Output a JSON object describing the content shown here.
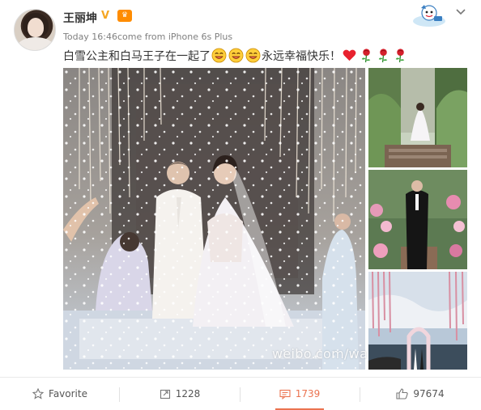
{
  "post": {
    "username": "王丽坤",
    "meta": "Today 16:46come from iPhone 6s Plus",
    "text_part1": "白雪公主和白马王子在一起了",
    "text_part2": "永远幸福快乐！",
    "watermark": "weibo.com/wa"
  },
  "icons": {
    "verified": "verified-v-icon",
    "member": "vip-crown-icon",
    "mascot": "weibo-mascot-icon",
    "menu": "chevron-down-icon",
    "emoji_laugh": "laughing-emoji-icon",
    "heart": "heart-emoji-icon",
    "rose": "rose-emoji-icon"
  },
  "actions": {
    "favorite_label": "Favorite",
    "repost_count": "1228",
    "comment_count": "1739",
    "like_count": "97674"
  },
  "colors": {
    "accent": "#eb7350",
    "verified": "#f5a623",
    "text": "#333333",
    "meta": "#808080"
  }
}
